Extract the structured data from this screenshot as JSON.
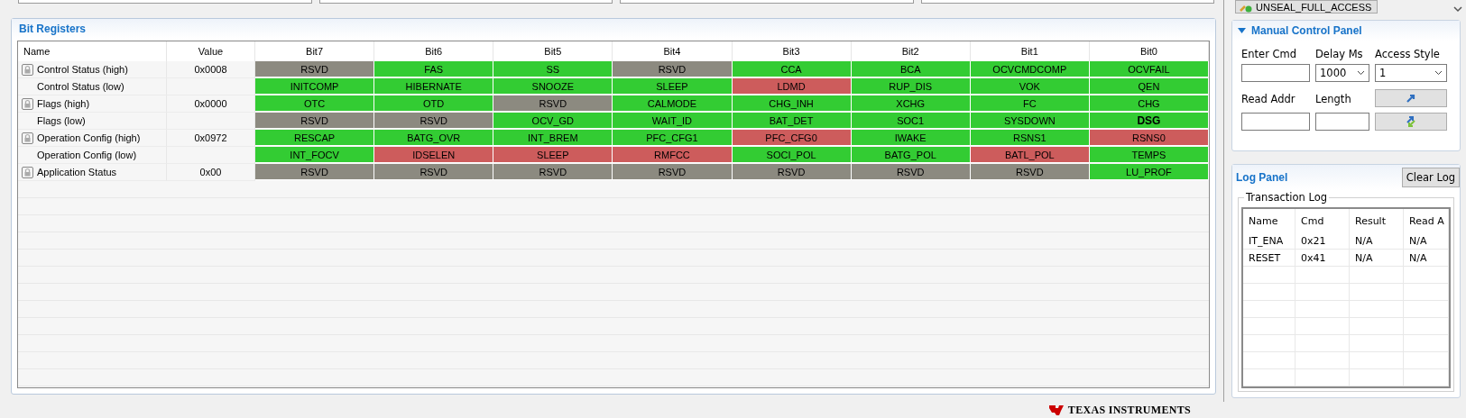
{
  "top_fields": [
    {
      "kind": "field"
    },
    {
      "kind": "field"
    },
    {
      "kind": "field"
    },
    {
      "kind": "field"
    }
  ],
  "unseal_button": {
    "label": "UNSEAL_FULL_ACCESS"
  },
  "bit_registers": {
    "title": "Bit Registers",
    "columns": [
      "Name",
      "Value",
      "Bit7",
      "Bit6",
      "Bit5",
      "Bit4",
      "Bit3",
      "Bit2",
      "Bit1",
      "Bit0"
    ],
    "rows": [
      {
        "name": "Control Status (high)",
        "locked": true,
        "value": "0x0008",
        "bits": [
          {
            "label": "RSVD",
            "color": "#8c8a80"
          },
          {
            "label": "FAS",
            "color": "#33cc33"
          },
          {
            "label": "SS",
            "color": "#33cc33"
          },
          {
            "label": "RSVD",
            "color": "#8c8a80"
          },
          {
            "label": "CCA",
            "color": "#33cc33"
          },
          {
            "label": "BCA",
            "color": "#33cc33"
          },
          {
            "label": "OCVCMDCOMP",
            "color": "#33cc33"
          },
          {
            "label": "OCVFAIL",
            "color": "#33cc33"
          }
        ]
      },
      {
        "name": "Control Status (low)",
        "locked": false,
        "value": "",
        "bits": [
          {
            "label": "INITCOMP",
            "color": "#33cc33"
          },
          {
            "label": "HIBERNATE",
            "color": "#33cc33"
          },
          {
            "label": "SNOOZE",
            "color": "#33cc33"
          },
          {
            "label": "SLEEP",
            "color": "#33cc33"
          },
          {
            "label": "LDMD",
            "color": "#cd5c5c"
          },
          {
            "label": "RUP_DIS",
            "color": "#33cc33"
          },
          {
            "label": "VOK",
            "color": "#33cc33"
          },
          {
            "label": "QEN",
            "color": "#33cc33"
          }
        ]
      },
      {
        "name": "Flags (high)",
        "locked": true,
        "value": "0x0000",
        "bits": [
          {
            "label": "OTC",
            "color": "#33cc33"
          },
          {
            "label": "OTD",
            "color": "#33cc33"
          },
          {
            "label": "RSVD",
            "color": "#8c8a80"
          },
          {
            "label": "CALMODE",
            "color": "#33cc33"
          },
          {
            "label": "CHG_INH",
            "color": "#33cc33"
          },
          {
            "label": "XCHG",
            "color": "#33cc33"
          },
          {
            "label": "FC",
            "color": "#33cc33"
          },
          {
            "label": "CHG",
            "color": "#33cc33"
          }
        ]
      },
      {
        "name": "Flags (low)",
        "locked": false,
        "value": "",
        "bits": [
          {
            "label": "RSVD",
            "color": "#8c8a80"
          },
          {
            "label": "RSVD",
            "color": "#8c8a80"
          },
          {
            "label": "OCV_GD",
            "color": "#33cc33"
          },
          {
            "label": "WAIT_ID",
            "color": "#33cc33"
          },
          {
            "label": "BAT_DET",
            "color": "#33cc33"
          },
          {
            "label": "SOC1",
            "color": "#33cc33"
          },
          {
            "label": "SYSDOWN",
            "color": "#33cc33"
          },
          {
            "label": "DSG",
            "color": "#33cc33",
            "bold": true
          }
        ]
      },
      {
        "name": "Operation Config (high)",
        "locked": true,
        "value": "0x0972",
        "bits": [
          {
            "label": "RESCAP",
            "color": "#33cc33"
          },
          {
            "label": "BATG_OVR",
            "color": "#33cc33"
          },
          {
            "label": "INT_BREM",
            "color": "#33cc33"
          },
          {
            "label": "PFC_CFG1",
            "color": "#33cc33"
          },
          {
            "label": "PFC_CFG0",
            "color": "#cd5c5c"
          },
          {
            "label": "IWAKE",
            "color": "#33cc33"
          },
          {
            "label": "RSNS1",
            "color": "#33cc33"
          },
          {
            "label": "RSNS0",
            "color": "#cd5c5c"
          }
        ]
      },
      {
        "name": "Operation Config (low)",
        "locked": false,
        "value": "",
        "bits": [
          {
            "label": "INT_FOCV",
            "color": "#33cc33"
          },
          {
            "label": "IDSELEN",
            "color": "#cd5c5c"
          },
          {
            "label": "SLEEP",
            "color": "#cd5c5c"
          },
          {
            "label": "RMFCC",
            "color": "#cd5c5c"
          },
          {
            "label": "SOCI_POL",
            "color": "#33cc33"
          },
          {
            "label": "BATG_POL",
            "color": "#33cc33"
          },
          {
            "label": "BATL_POL",
            "color": "#cd5c5c"
          },
          {
            "label": "TEMPS",
            "color": "#33cc33"
          }
        ]
      },
      {
        "name": "Application Status",
        "locked": true,
        "value": "0x00",
        "bits": [
          {
            "label": "RSVD",
            "color": "#8c8a80"
          },
          {
            "label": "RSVD",
            "color": "#8c8a80"
          },
          {
            "label": "RSVD",
            "color": "#8c8a80"
          },
          {
            "label": "RSVD",
            "color": "#8c8a80"
          },
          {
            "label": "RSVD",
            "color": "#8c8a80"
          },
          {
            "label": "RSVD",
            "color": "#8c8a80"
          },
          {
            "label": "RSVD",
            "color": "#8c8a80"
          },
          {
            "label": "LU_PROF",
            "color": "#33cc33"
          }
        ]
      }
    ]
  },
  "manual_control_panel": {
    "title": "Manual Control Panel",
    "expanded": true,
    "enter_cmd": {
      "label": "Enter Cmd"
    },
    "delay_ms": {
      "label": "Delay Ms",
      "value": "1000"
    },
    "access_style": {
      "label": "Access Style",
      "value": "1"
    },
    "read_addr": {
      "label": "Read Addr"
    },
    "length": {
      "label": "Length"
    }
  },
  "log_panel": {
    "title": "Log Panel",
    "clear_button": "Clear Log",
    "group_title": "Transaction Log",
    "columns": [
      "Name",
      "Cmd",
      "Result",
      "Read A"
    ],
    "rows": [
      [
        "IT_ENA",
        "0x21",
        "N/A",
        "N/A"
      ],
      [
        "RESET",
        "0x41",
        "N/A",
        "N/A"
      ]
    ]
  },
  "footer": {
    "logo_text": "TEXAS INSTRUMENTS"
  }
}
